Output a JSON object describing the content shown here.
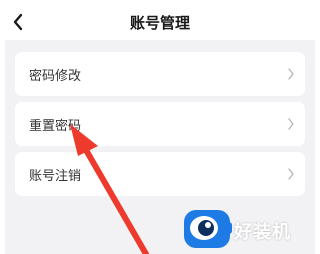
{
  "header": {
    "title": "账号管理",
    "back_icon": "chevron-left-icon"
  },
  "menu": {
    "items": [
      {
        "label": "密码修改",
        "icon": "chevron-right-icon"
      },
      {
        "label": "重置密码",
        "icon": "chevron-right-icon"
      },
      {
        "label": "账号注销",
        "icon": "chevron-right-icon"
      }
    ]
  },
  "annotation": {
    "arrow_color": "#ee3a2c"
  },
  "watermark": {
    "text": "好装机",
    "logo_color": "#1e7be6"
  }
}
